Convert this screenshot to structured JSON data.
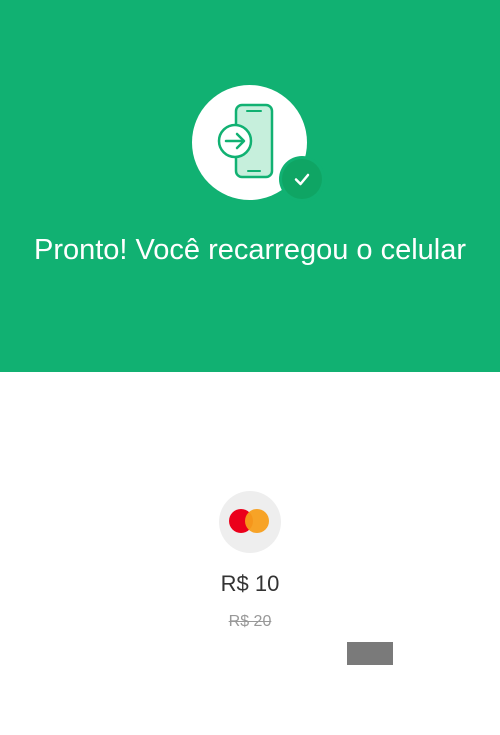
{
  "header": {
    "title": "Pronto! Você recarregou o celular",
    "background_color": "#11b172",
    "icon": "phone-recharge-icon",
    "badge_icon": "check-icon"
  },
  "payment": {
    "method_icon": "mastercard-icon",
    "amount": "R$ 10",
    "original_amount": "R$ 20"
  }
}
